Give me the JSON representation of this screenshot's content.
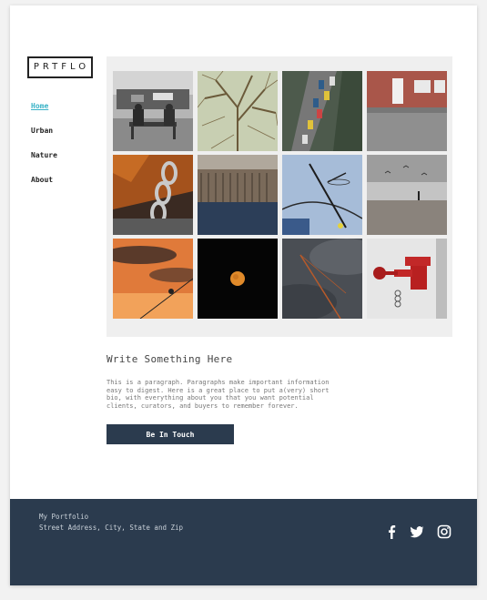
{
  "brand": {
    "logo": "PRTFLO"
  },
  "nav": {
    "items": [
      {
        "label": "Home",
        "active": true
      },
      {
        "label": "Urban"
      },
      {
        "label": "Nature"
      },
      {
        "label": "About"
      }
    ]
  },
  "gallery": {
    "photos": [
      "people-on-bench",
      "bare-tree-branches",
      "aerial-parking-lot",
      "brick-building-rain",
      "rusty-chain",
      "bridge-reflection",
      "dragonfly-on-twig",
      "beach-with-birds",
      "bird-on-wire-sunset",
      "full-moon",
      "crane-storm-clouds",
      "red-fire-hydrant"
    ]
  },
  "content": {
    "heading": "Write Something Here",
    "paragraph": "This is a paragraph. Paragraphs make important information\neasy to digest. Here is a great place to put a(very) short\nbio, with everything about you that you want potential\nclients, curators, and buyers to remember forever.",
    "button_label": "Be In Touch"
  },
  "footer": {
    "line1": "My Portfolio",
    "line2": "Street Address, City, State and Zip",
    "social": [
      "facebook-icon",
      "twitter-icon",
      "instagram-icon"
    ]
  },
  "colors": {
    "accent": "#3ab3c7",
    "dark": "#2b3b4e",
    "gallery_bg": "#efefef"
  }
}
